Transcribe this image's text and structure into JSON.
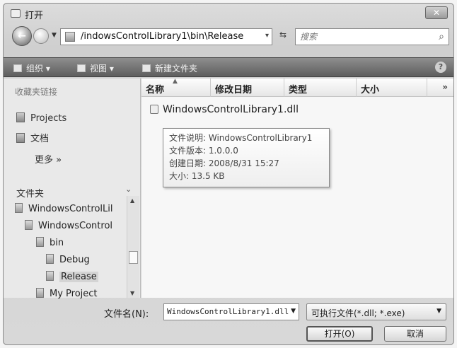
{
  "window": {
    "title": "打开",
    "close_label": "✕"
  },
  "address": {
    "path": "/indowsControlLibrary1\\bin\\Release",
    "dropdown": "▾",
    "refresh": "⇆"
  },
  "search": {
    "placeholder": "搜索"
  },
  "toolbar": {
    "organize": "组织 ▾",
    "views": "视图 ▾",
    "new_folder": "新建文件夹",
    "help": "?"
  },
  "favorites": {
    "header": "收藏夹链接",
    "items": [
      {
        "label": "Projects"
      },
      {
        "label": "文档"
      }
    ],
    "more": "更多 »"
  },
  "folders": {
    "header": "文件夹",
    "toggle": "⌄",
    "items": [
      {
        "label": "WindowsControlLil"
      },
      {
        "label": "WindowsControl"
      },
      {
        "label": "bin"
      },
      {
        "label": "Debug"
      },
      {
        "label": "Release"
      },
      {
        "label": "My Project"
      }
    ]
  },
  "columns": {
    "name": "名称",
    "modified": "修改日期",
    "type": "类型",
    "size": "大小",
    "more": "»"
  },
  "files": [
    {
      "name": "WindowsControlLibrary1.dll"
    }
  ],
  "tooltip": {
    "description": "文件说明: WindowsControlLibrary1",
    "version": "文件版本: 1.0.0.0",
    "created": "创建日期: 2008/8/31 15:27",
    "size": "大小: 13.5 KB"
  },
  "bottom": {
    "filename_label": "文件名(N):",
    "filename_value": "WindowsControlLibrary1.dll",
    "filter_value": "可执行文件(*.dll; *.exe)",
    "open_label": "打开(O)",
    "cancel_label": "取消"
  },
  "colors": {
    "toolbar": "#6e6e6e",
    "dialog": "#d4d4d4",
    "tooltip_border": "#888888"
  }
}
